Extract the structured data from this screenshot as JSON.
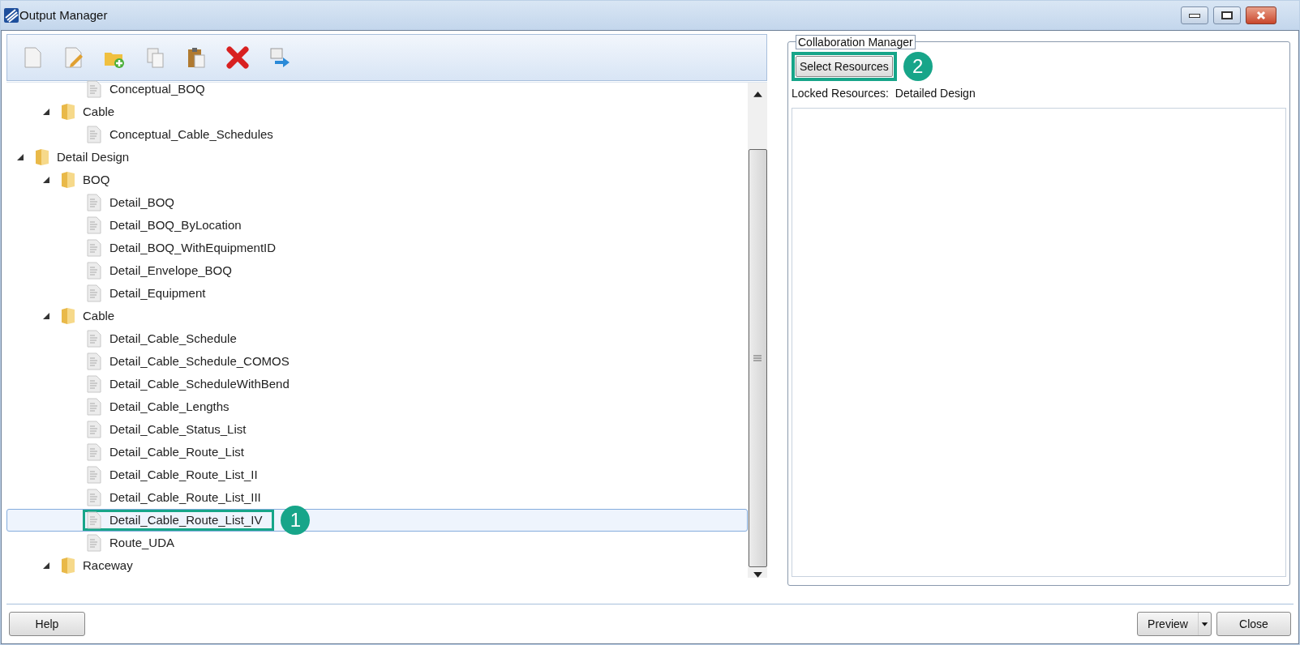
{
  "window": {
    "title": "Output Manager"
  },
  "tree": {
    "items": [
      {
        "kind": "folder",
        "children": [
          {
            "kind": "folder",
            "children": [
              {
                "kind": "report",
                "label": "Conceptual_BOQ",
                "selected": false
              }
            ]
          },
          {
            "kind": "folder",
            "label": "Cable",
            "expanded": true,
            "children": [
              {
                "kind": "report",
                "label": "Conceptual_Cable_Schedules",
                "selected": false
              }
            ]
          }
        ]
      },
      {
        "kind": "folder",
        "label": "Detail Design",
        "expanded": true,
        "children": [
          {
            "kind": "folder",
            "label": "BOQ",
            "expanded": true,
            "children": [
              {
                "kind": "report",
                "label": "Detail_BOQ",
                "selected": false
              },
              {
                "kind": "report",
                "label": "Detail_BOQ_ByLocation",
                "selected": false
              },
              {
                "kind": "report",
                "label": "Detail_BOQ_WithEquipmentID",
                "selected": false
              },
              {
                "kind": "report",
                "label": "Detail_Envelope_BOQ",
                "selected": false
              },
              {
                "kind": "report",
                "label": "Detail_Equipment",
                "selected": false
              }
            ]
          },
          {
            "kind": "folder",
            "label": "Cable",
            "expanded": true,
            "children": [
              {
                "kind": "report",
                "label": "Detail_Cable_Schedule",
                "selected": false
              },
              {
                "kind": "report",
                "label": "Detail_Cable_Schedule_COMOS",
                "selected": false
              },
              {
                "kind": "report",
                "label": "Detail_Cable_ScheduleWithBend",
                "selected": false
              },
              {
                "kind": "report",
                "label": "Detail_Cable_Lengths",
                "selected": false
              },
              {
                "kind": "report",
                "label": "Detail_Cable_Status_List",
                "selected": false
              },
              {
                "kind": "report",
                "label": "Detail_Cable_Route_List",
                "selected": false
              },
              {
                "kind": "report",
                "label": "Detail_Cable_Route_List_II",
                "selected": false
              },
              {
                "kind": "report",
                "label": "Detail_Cable_Route_List_III",
                "selected": false
              },
              {
                "kind": "report",
                "label": "Detail_Cable_Route_List_IV",
                "selected": true,
                "callout": "1"
              },
              {
                "kind": "report",
                "label": "Route_UDA",
                "selected": false
              }
            ]
          },
          {
            "kind": "folder",
            "label": "Raceway",
            "expanded": true
          }
        ]
      }
    ]
  },
  "collaboration": {
    "title": "Collaboration Manager",
    "button": {
      "label": "Select Resources",
      "callout": "2"
    },
    "locked_label": "Locked Resources:",
    "locked_value": "Detailed Design"
  },
  "footer": {
    "help": "Help",
    "preview": "Preview",
    "close": "Close"
  }
}
